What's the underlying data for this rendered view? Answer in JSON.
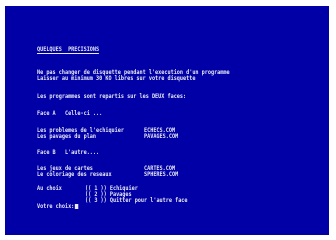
{
  "screen": {
    "title": "QUELQUES  PRECISIONS",
    "notice_line1": "Ne pas changer de disquette pendant l'execution d'un programme",
    "notice_line2": "Laisser au minimum 30 KO libres sur votre disquette",
    "programs_intro": "Les programmes sont repartis sur les DEUX faces:",
    "face_a_header": "Face A   Celle-ci ...",
    "face_a_items": [
      {
        "label": "Les problemes de l'echiquier",
        "file": "ECHECS.COM"
      },
      {
        "label": "Les pavages du plan",
        "file": "PAVAGES.COM"
      }
    ],
    "face_b_header": "Face B   L'autre....",
    "face_b_items": [
      {
        "label": "Les jeux de cartes",
        "file": "CARTES.COM"
      },
      {
        "label": "Le coloriage des reseaux",
        "file": "SPHERES.COM"
      }
    ],
    "menu_prompt": "Au choix",
    "menu_options": [
      "(( 1 )) Echiquier",
      "(( 2 )) Pavages",
      "(( 3 )) Quitter pour l'autre face"
    ],
    "input_prompt": "Votre choix:"
  },
  "colors": {
    "background": "#0000a6",
    "text": "#e8e8f8",
    "border": "#ffffff"
  }
}
